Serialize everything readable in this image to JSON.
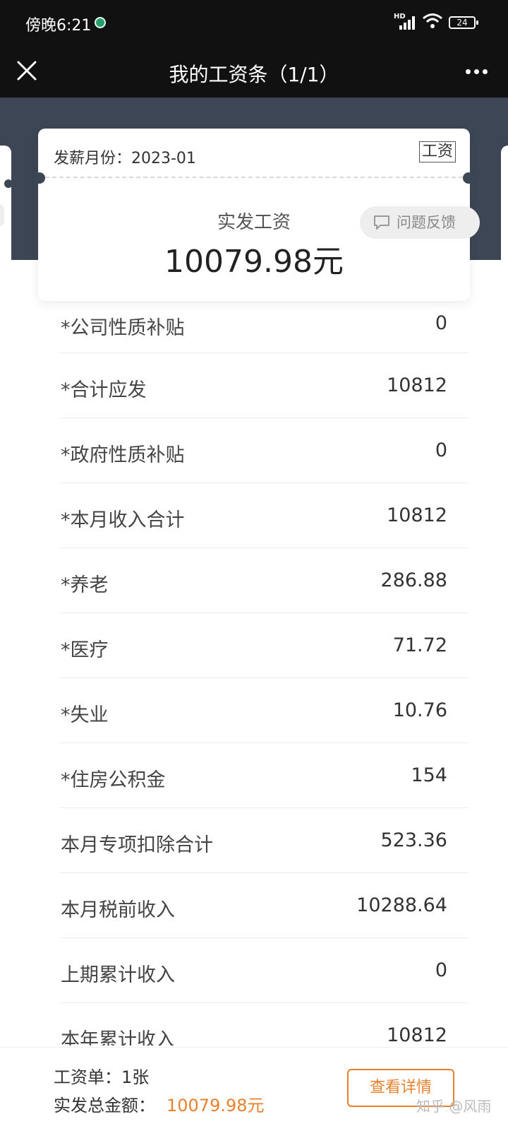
{
  "status_bar": {
    "time": "傍晚6:21",
    "network": "HD",
    "battery": "24"
  },
  "nav": {
    "title": "我的工资条（1/1）"
  },
  "card": {
    "month_label": "发薪月份：2023-01",
    "type_tag": "工资",
    "net_label": "实发工资",
    "net_amount": "10079.98元",
    "feedback_label": "问题反馈"
  },
  "items": [
    {
      "label": "*公司性质补贴",
      "value": "0"
    },
    {
      "label": "*合计应发",
      "value": "10812"
    },
    {
      "label": "*政府性质补贴",
      "value": "0"
    },
    {
      "label": "*本月收入合计",
      "value": "10812"
    },
    {
      "label": "*养老",
      "value": "286.88"
    },
    {
      "label": "*医疗",
      "value": "71.72"
    },
    {
      "label": "*失业",
      "value": "10.76"
    },
    {
      "label": "*住房公积金",
      "value": "154"
    },
    {
      "label": "本月专项扣除合计",
      "value": "523.36"
    },
    {
      "label": "本月税前收入",
      "value": "10288.64"
    },
    {
      "label": "上期累计收入",
      "value": "0"
    },
    {
      "label": "本年累计收入",
      "value": "10812"
    }
  ],
  "footer": {
    "count": "工资单：1张",
    "total_label": "实发总金额：",
    "total_value": "10079.98元",
    "detail_button": "查看详情"
  },
  "watermark": "知乎 @风雨",
  "colors": {
    "accent": "#e8812d",
    "header": "#111111",
    "band": "#3d4654"
  }
}
